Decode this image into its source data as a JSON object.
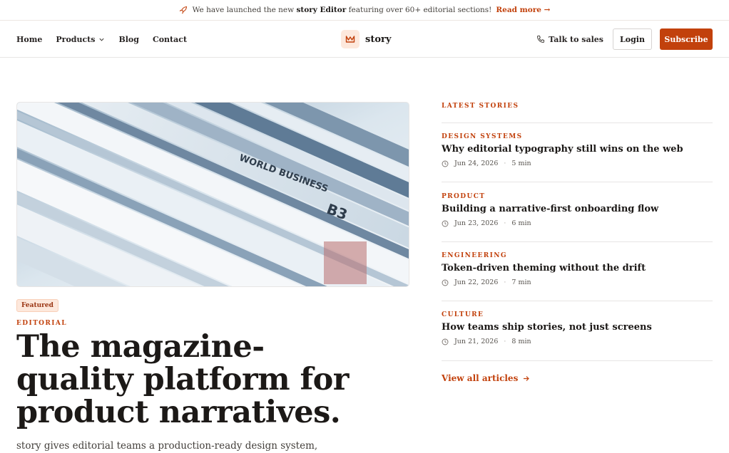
{
  "announcement": {
    "prefix": "We have launched the new",
    "highlight": "story Editor",
    "suffix": "featuring over 60+ editorial sections!",
    "link": "Read more →"
  },
  "nav": {
    "links": [
      "Home",
      "Products",
      "Blog",
      "Contact"
    ],
    "brand": "story",
    "talk": "Talk to sales",
    "login": "Login",
    "subscribe": "Subscribe"
  },
  "hero": {
    "badge": "Featured",
    "kicker": "EDITORIAL",
    "headline": "The magazine-quality platform for product narratives.",
    "lede": "story gives editorial teams a production-ready design system,"
  },
  "latest": {
    "title": "LATEST STORIES",
    "stories": [
      {
        "category": "DESIGN SYSTEMS",
        "title": "Why editorial typography still wins on the web",
        "date": "Jun 24, 2026",
        "read": "5 min"
      },
      {
        "category": "PRODUCT",
        "title": "Building a narrative-first onboarding flow",
        "date": "Jun 23, 2026",
        "read": "6 min"
      },
      {
        "category": "ENGINEERING",
        "title": "Token-driven theming without the drift",
        "date": "Jun 22, 2026",
        "read": "7 min"
      },
      {
        "category": "CULTURE",
        "title": "How teams ship stories, not just screens",
        "date": "Jun 21, 2026",
        "read": "8 min"
      }
    ],
    "view_all": "View all articles"
  },
  "colors": {
    "accent": "#c2410c",
    "badge_bg": "#fde8dc",
    "text": "#1c1917"
  }
}
